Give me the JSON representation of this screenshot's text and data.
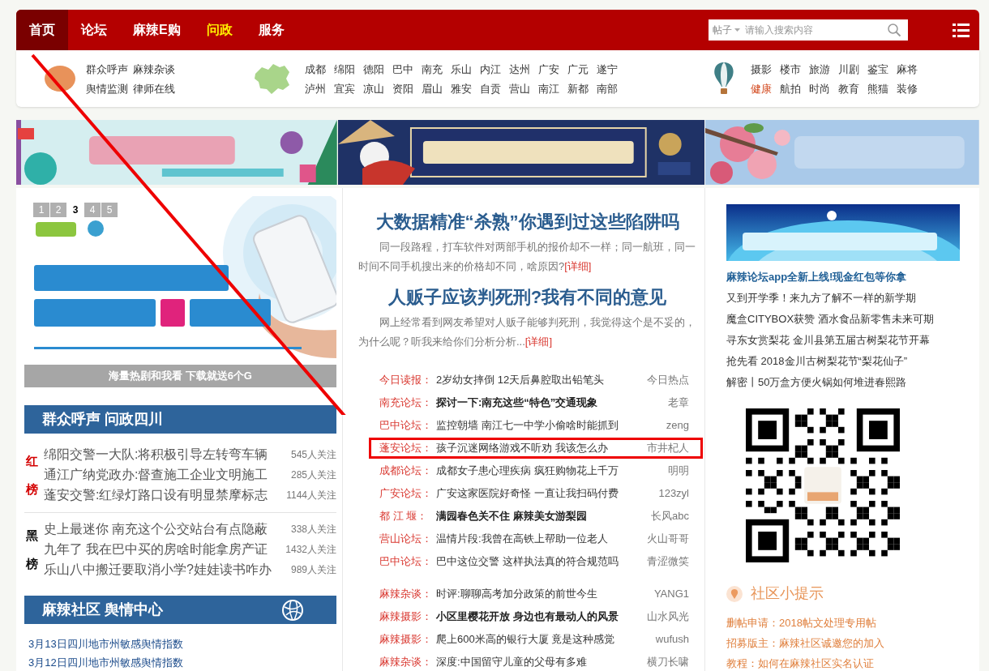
{
  "nav": {
    "items": [
      {
        "label": "首页",
        "selected": true,
        "kind": "normal"
      },
      {
        "label": "论坛",
        "selected": false,
        "kind": "normal"
      },
      {
        "label": "麻辣E购",
        "selected": false,
        "kind": "normal"
      },
      {
        "label": "问政",
        "selected": false,
        "kind": "highlight"
      },
      {
        "label": "服务",
        "selected": false,
        "kind": "normal"
      }
    ],
    "search": {
      "scope": "帖子",
      "placeholder": "请输入搜索内容"
    }
  },
  "quick_links": [
    {
      "rows": [
        [
          {
            "label": "群众呼声",
            "kind": "plain"
          },
          {
            "label": "麻辣杂谈",
            "kind": "plain"
          }
        ],
        [
          {
            "label": "舆情监测",
            "kind": "plain"
          },
          {
            "label": "律师在线",
            "kind": "plain"
          }
        ]
      ]
    },
    {
      "rows": [
        [
          {
            "label": "成都",
            "kind": "plain"
          },
          {
            "label": "绵阳",
            "kind": "plain"
          },
          {
            "label": "德阳",
            "kind": "plain"
          },
          {
            "label": "巴中",
            "kind": "plain"
          },
          {
            "label": "南充",
            "kind": "plain"
          },
          {
            "label": "乐山",
            "kind": "plain"
          },
          {
            "label": "内江",
            "kind": "plain"
          },
          {
            "label": "达州",
            "kind": "plain"
          },
          {
            "label": "广安",
            "kind": "plain"
          },
          {
            "label": "广元",
            "kind": "plain"
          },
          {
            "label": "遂宁",
            "kind": "plain"
          }
        ],
        [
          {
            "label": "泸州",
            "kind": "plain"
          },
          {
            "label": "宜宾",
            "kind": "plain"
          },
          {
            "label": "凉山",
            "kind": "plain"
          },
          {
            "label": "资阳",
            "kind": "plain"
          },
          {
            "label": "眉山",
            "kind": "plain"
          },
          {
            "label": "雅安",
            "kind": "plain"
          },
          {
            "label": "自贡",
            "kind": "plain"
          },
          {
            "label": "营山",
            "kind": "plain"
          },
          {
            "label": "南江",
            "kind": "plain"
          },
          {
            "label": "新都",
            "kind": "plain"
          },
          {
            "label": "南部",
            "kind": "plain"
          }
        ]
      ]
    },
    {
      "rows": [
        [
          {
            "label": "摄影",
            "kind": "plain"
          },
          {
            "label": "楼市",
            "kind": "plain"
          },
          {
            "label": "旅游",
            "kind": "plain"
          },
          {
            "label": "川剧",
            "kind": "plain"
          },
          {
            "label": "鉴宝",
            "kind": "plain"
          },
          {
            "label": "麻将",
            "kind": "plain"
          }
        ],
        [
          {
            "label": "健康",
            "kind": "hot"
          },
          {
            "label": "航拍",
            "kind": "plain"
          },
          {
            "label": "时尚",
            "kind": "plain"
          },
          {
            "label": "教育",
            "kind": "plain"
          },
          {
            "label": "熊猫",
            "kind": "plain"
          },
          {
            "label": "装修",
            "kind": "plain"
          }
        ]
      ]
    }
  ],
  "slideshow": {
    "pages": [
      {
        "label": "1",
        "selected": false
      },
      {
        "label": "2",
        "selected": false
      },
      {
        "label": "3",
        "selected": true
      },
      {
        "label": "4",
        "selected": false
      },
      {
        "label": "5",
        "selected": false
      }
    ],
    "caption": "海量热剧和我看 下载就送6个G"
  },
  "voice": {
    "title": "群众呼声 问政四川",
    "boards": [
      {
        "label": "红榜",
        "kind": "red",
        "rows": [
          {
            "title": "绵阳交警一大队:将积极引导左转弯车辆",
            "count": "545人关注"
          },
          {
            "title": "通江广纳党政办:督查施工企业文明施工",
            "count": "285人关注"
          },
          {
            "title": "蓬安交警:红绿灯路口设有明显禁摩标志",
            "count": "1144人关注"
          }
        ]
      },
      {
        "label": "黑榜",
        "kind": "black",
        "rows": [
          {
            "title": "史上最迷你 南充这个公交站台有点隐蔽",
            "count": "338人关注"
          },
          {
            "title": "九年了 我在巴中买的房啥时能拿房产证",
            "count": "1432人关注"
          },
          {
            "title": "乐山八中搬迁要取消小学?娃娃读书咋办",
            "count": "989人关注"
          }
        ]
      }
    ]
  },
  "sentiment": {
    "title": "麻辣社区 舆情中心",
    "links": [
      "3月13日四川地市州敏感舆情指数",
      "3月12日四川地市州敏感舆情指数"
    ]
  },
  "features": [
    {
      "headline": "大数据精准“杀熟”你遇到过这些陷阱吗",
      "summary": "同一段路程，打车软件对两部手机的报价却不一样；同一航班，同一时间不同手机搜出来的价格却不同，啥原因?",
      "more": "[详细]"
    },
    {
      "headline": "人贩子应该判死刑?我有不同的意见",
      "summary": "网上经常看到网友希望对人贩子能够判死刑，我觉得这个是不妥的，为什么呢？听我来给你们分析分析...",
      "more": "[详细]"
    }
  ],
  "post_lists": [
    [
      {
        "forum": "今日读报：",
        "title": "2岁幼女摔倒 12天后鼻腔取出铅笔头",
        "author": "今日热点",
        "bold": false,
        "highlighted": false
      },
      {
        "forum": "南充论坛：",
        "title": "探讨一下:南充这些“特色”交通现象",
        "author": "老章",
        "bold": true,
        "highlighted": false
      },
      {
        "forum": "巴中论坛：",
        "title": "监控朝墙 南江七一中学小偷啥时能抓到",
        "author": "zeng",
        "bold": false,
        "highlighted": false
      },
      {
        "forum": "蓬安论坛：",
        "title": "孩子沉迷网络游戏不听劝 我该怎么办",
        "author": "市井杞人",
        "bold": false,
        "highlighted": true
      },
      {
        "forum": "成都论坛：",
        "title": "成都女子患心理疾病 疯狂购物花上千万",
        "author": "明明",
        "bold": false,
        "highlighted": false
      },
      {
        "forum": "广安论坛：",
        "title": "广安这家医院好奇怪 一直让我扫码付费",
        "author": "123zyl",
        "bold": false,
        "highlighted": false
      },
      {
        "forum": "都 江 堰：",
        "title": "满园春色关不住 麻辣美女游梨园",
        "author": "长风abc",
        "bold": true,
        "highlighted": false
      },
      {
        "forum": "营山论坛：",
        "title": "温情片段:我曾在高铁上帮助一位老人",
        "author": "火山哥哥",
        "bold": false,
        "highlighted": false
      },
      {
        "forum": "巴中论坛：",
        "title": "巴中这位交警 这样执法真的符合规范吗",
        "author": "青涩微笑",
        "bold": false,
        "highlighted": false
      }
    ],
    [
      {
        "forum": "麻辣杂谈：",
        "title": "时评:聊聊高考加分政策的前世今生",
        "author": "YANG1",
        "bold": false,
        "highlighted": false
      },
      {
        "forum": "麻辣摄影：",
        "title": "小区里樱花开放 身边也有最动人的风景",
        "author": "山水风光",
        "bold": true,
        "highlighted": false
      },
      {
        "forum": "麻辣摄影：",
        "title": "爬上600米高的银行大厦 竟是这种感觉",
        "author": "wufush",
        "bold": false,
        "highlighted": false
      },
      {
        "forum": "麻辣杂谈：",
        "title": "深度:中国留守儿童的父母有多难",
        "author": "横刀长啸",
        "bold": false,
        "highlighted": false
      }
    ]
  ],
  "annotation": {
    "arrow": true
  },
  "sidebar": {
    "featured": "麻辣论坛app全新上线!现金红包等你拿",
    "links": [
      "又到开学季！来九方了解不一样的新学期",
      "魔盒CITYBOX获赞 酒水食品新零售未来可期",
      "寻东女赏梨花 金川县第五届古树梨花节开幕",
      "抢先看 2018金川古树梨花节“梨花仙子”",
      "解密丨50万盒方便火锅如何堆进春熙路"
    ],
    "tips": {
      "title": "社区小提示",
      "items": [
        "删帖申请：2018帖文处理专用帖",
        "招募版主：麻辣社区诚邀您的加入",
        "教程：如何在麻辣社区实名认证"
      ]
    }
  }
}
